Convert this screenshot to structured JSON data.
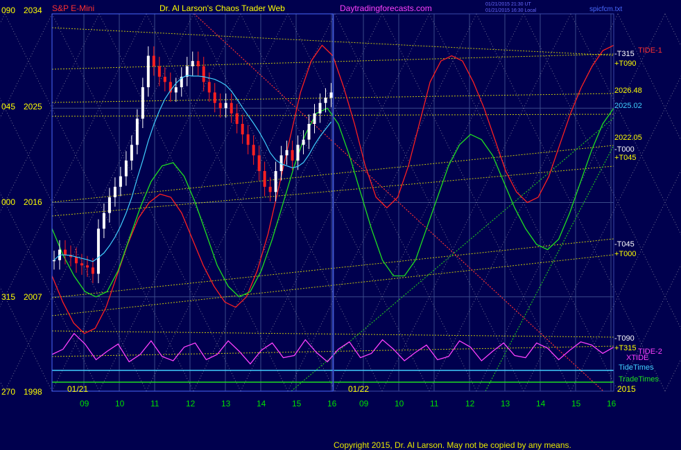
{
  "header": {
    "instrument": "S&P E-Mini",
    "title": "Dr. Al Larson's Chaos Trader Web",
    "site": "Daytradingforecasts.com",
    "timestamp_line1": "01/21/2015 21:30 UT",
    "timestamp_line2": "01/21/2015 16:30 Local",
    "filename": "spicfcm.txt"
  },
  "copyright": "Copyright 2015, Dr. Al Larson. May not be copied by any means.",
  "colors": {
    "background": "#00004e",
    "axis_text": "#ffff00",
    "time_text": "#00e000",
    "red": "#ff2020",
    "magenta": "#ff40ff",
    "cyan": "#40d0ff",
    "green": "#20e020",
    "white": "#ffffff",
    "grid": "#5a6a8a"
  },
  "chart_data": {
    "type": "line",
    "title": "S&P E-Mini",
    "xlabel": "",
    "ylabel": "",
    "ylim": [
      1998,
      2034
    ],
    "y_ticks": [
      {
        "value": 2034,
        "label": "2034",
        "angle": "090"
      },
      {
        "value": 2025,
        "label": "2025",
        "angle": "045"
      },
      {
        "value": 2016,
        "label": "2016",
        "angle": "000"
      },
      {
        "value": 2007,
        "label": "2007",
        "angle": "315"
      },
      {
        "value": 1998,
        "label": "1998",
        "angle": "270"
      }
    ],
    "x_ticks_day1": [
      "09",
      "10",
      "11",
      "12",
      "13",
      "14",
      "15",
      "16"
    ],
    "x_ticks_day2": [
      "09",
      "10",
      "11",
      "12",
      "13",
      "14",
      "15",
      "16"
    ],
    "x_range_hours": [
      8.1,
      16.0
    ],
    "date_labels": [
      "01/21",
      "01/22"
    ],
    "year_label": "2015",
    "grid": true,
    "right_labels": [
      {
        "text": "-T315",
        "color": "#ffffff"
      },
      {
        "text": "TIDE-1",
        "color": "#ff3030"
      },
      {
        "text": "+T090",
        "color": "#ffff00"
      },
      {
        "text": "2026.48",
        "color": "#ffff00"
      },
      {
        "text": "2025.02",
        "color": "#40d0ff"
      },
      {
        "text": "2022.05",
        "color": "#ffff00"
      },
      {
        "text": "-T000",
        "color": "#ffffff"
      },
      {
        "text": "+T045",
        "color": "#ffff00"
      },
      {
        "text": "-T045",
        "color": "#ffffff"
      },
      {
        "text": "+T000",
        "color": "#ffff00"
      },
      {
        "text": "-T090",
        "color": "#ffffff"
      },
      {
        "text": "+T315",
        "color": "#ffff00"
      },
      {
        "text": "TIDE-2",
        "color": "#ff40ff"
      },
      {
        "text": "XTIDE",
        "color": "#ff40ff"
      },
      {
        "text": "TideTimes",
        "color": "#40d0ff"
      },
      {
        "text": "TradeTimes",
        "color": "#20e020"
      }
    ],
    "day1_price_closes": [
      2010.5,
      2011.5,
      2011.0,
      2010.8,
      2010.2,
      2010.0,
      2009.8,
      2009.2,
      2013.5,
      2015.0,
      2016.5,
      2017.5,
      2018.5,
      2020.0,
      2021.5,
      2024.0,
      2027.0,
      2030.0,
      2029.0,
      2028.0,
      2027.5,
      2026.5,
      2027.0,
      2028.0,
      2029.0,
      2029.5,
      2029.0,
      2027.5,
      2026.5,
      2025.5,
      2025.0,
      2025.5,
      2024.5,
      2023.5,
      2022.5,
      2021.5,
      2020.5,
      2019.0,
      2017.5,
      2017.0,
      2019.0,
      2020.5,
      2021.0,
      2020.0,
      2021.5,
      2022.0,
      2023.5,
      2024.5,
      2025.5,
      2026.0,
      2026.5
    ],
    "series": [
      {
        "name": "",
        "color": "#ff2020",
        "values": [
          2009.0,
          2006.5,
          2004.5,
          2003.5,
          2004.0,
          2006.0,
          2009.0,
          2012.0,
          2014.5,
          2016.0,
          2016.8,
          2016.5,
          2015.0,
          2012.5,
          2010.0,
          2008.0,
          2006.5,
          2006.0,
          2007.0,
          2009.5,
          2013.0,
          2017.5,
          2022.0,
          2026.5,
          2029.5,
          2031.0,
          2030.0,
          2027.0,
          2023.5,
          2019.5,
          2016.5,
          2015.5,
          2016.5,
          2019.5,
          2023.5,
          2027.5,
          2029.5,
          2030.0,
          2029.5,
          2027.5,
          2025.0,
          2022.0,
          2019.0,
          2017.0,
          2016.0,
          2016.5,
          2018.5,
          2021.5,
          2024.5,
          2027.0,
          2029.0,
          2030.5,
          2031.0
        ]
      },
      {
        "name": "",
        "color": "#20e020",
        "values": [
          2013.5,
          2011.0,
          2009.0,
          2007.5,
          2007.0,
          2007.5,
          2009.5,
          2012.5,
          2015.5,
          2018.0,
          2019.5,
          2019.8,
          2018.5,
          2016.0,
          2013.0,
          2010.0,
          2008.0,
          2007.0,
          2007.5,
          2009.5,
          2012.5,
          2016.0,
          2019.5,
          2022.5,
          2024.5,
          2025.0,
          2023.5,
          2020.5,
          2017.0,
          2013.5,
          2010.5,
          2009.0,
          2009.0,
          2010.5,
          2013.5,
          2016.5,
          2019.5,
          2021.5,
          2022.5,
          2022.0,
          2020.5,
          2018.0,
          2015.5,
          2013.5,
          2012.0,
          2011.5,
          2012.5,
          2015.0,
          2018.0,
          2021.0,
          2023.5,
          2025.0
        ]
      },
      {
        "name": "",
        "color": "#ff40ff",
        "values": [
          2001.5,
          2002.0,
          2003.5,
          2002.5,
          2001.0,
          2001.8,
          2002.5,
          2000.8,
          2001.5,
          2002.8,
          2001.3,
          2000.9,
          2002.2,
          2002.6,
          2001.0,
          2001.5,
          2002.8,
          2001.8,
          2000.6,
          2001.9,
          2002.6,
          2001.2,
          2001.4,
          2002.9,
          2001.7,
          2000.8,
          2002.0,
          2002.7,
          2001.2,
          2001.6,
          2002.9,
          2002.0,
          2000.9,
          2001.7,
          2002.4,
          2001.0,
          2001.3,
          2002.8,
          2002.2,
          2000.9,
          2001.8,
          2002.6,
          2001.4,
          2001.2,
          2002.6,
          2002.1,
          2001.0,
          2001.9,
          2002.7,
          2002.4,
          2001.6,
          2002.2
        ]
      }
    ]
  }
}
